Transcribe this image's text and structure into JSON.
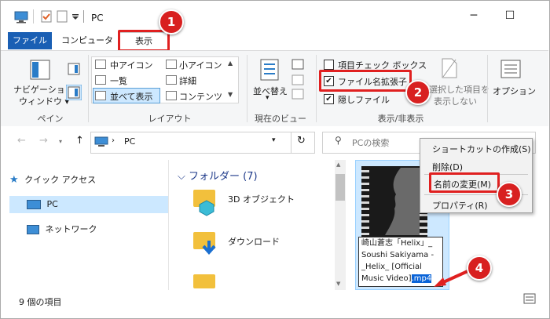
{
  "window": {
    "title": "PC",
    "qat_icons": [
      "computer-icon",
      "properties-check-icon",
      "new-folder-icon",
      "dropdown-arrow-icon"
    ],
    "minimize": "─",
    "maximize": "☐"
  },
  "tabs": {
    "file": "ファイル",
    "computer": "コンピューター",
    "view": "表示"
  },
  "ribbon": {
    "pane_group": {
      "nav_pane": "ナビゲーション",
      "nav_pane2": "ウィンドウ",
      "label": "ペイン"
    },
    "layout_group": {
      "medium_icons": "中アイコン",
      "small_icons": "小アイコン",
      "list": "一覧",
      "details": "詳細",
      "tiles": "並べて表示",
      "content": "コンテンツ",
      "label": "レイアウト"
    },
    "current_view_group": {
      "sort": "並べ替え",
      "label": "現在のビュー"
    },
    "show_hide_group": {
      "item_checkbox": "項目チェック ボックス",
      "file_ext": "ファイル名拡張子",
      "hidden_files": "隠しファイル",
      "hide_selected": "選択した項目を",
      "hide_selected2": "表示しない",
      "label": "表示/非表示",
      "item_checkbox_checked": false,
      "file_ext_checked": true,
      "hidden_files_checked": true
    },
    "options": "オプション"
  },
  "address": {
    "path": "PC",
    "search_placeholder": "PCの検索"
  },
  "nav_pane": {
    "items": [
      "クイック アクセス",
      "PC",
      "ネットワーク"
    ]
  },
  "content": {
    "group_header": "フォルダー (7)",
    "folders": [
      "3D オブジェクト",
      "ダウンロード"
    ],
    "rename_lines": [
      "崎山蒼志「Helix」_",
      "Soushi Sakiyama -",
      "_Helix_ [Official",
      "Music Video]"
    ],
    "rename_ext": ".mp4"
  },
  "context_menu": {
    "items": [
      "ショートカットの作成(S)",
      "削除(D)",
      "名前の変更(M)",
      "プロパティ(R)"
    ]
  },
  "status": {
    "count": "9 個の項目"
  },
  "badges": [
    "1",
    "2",
    "3",
    "4"
  ],
  "colors": {
    "accent": "#1a5fb4",
    "annotation": "#e02020",
    "selection": "#cde8ff",
    "text_select": "#0a64d8"
  }
}
